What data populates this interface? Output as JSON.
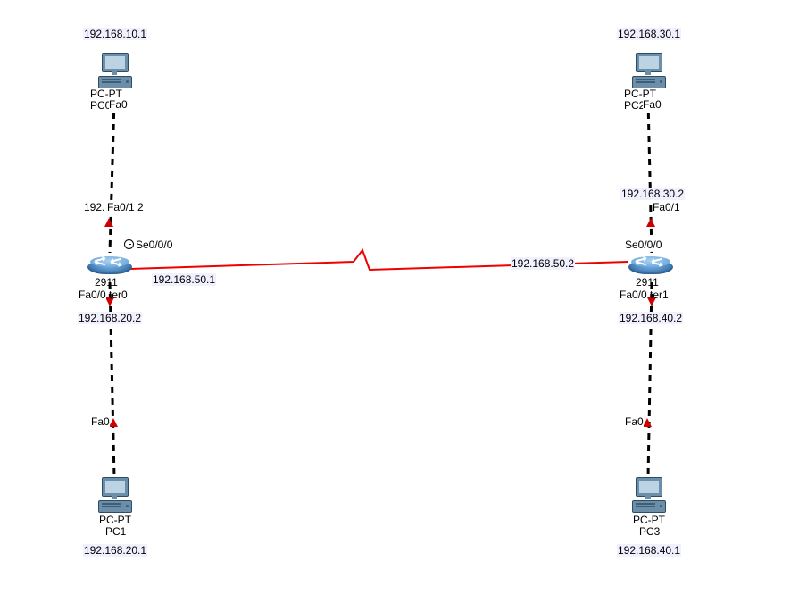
{
  "devices": {
    "pc0": {
      "type_label": "PC-PT",
      "host_label": "PC0",
      "ip": "192.168.10.1",
      "port": "Fa0"
    },
    "pc1": {
      "type_label": "PC-PT",
      "host_label": "PC1",
      "ip": "192.168.20.1",
      "port": "Fa0"
    },
    "pc2": {
      "type_label": "PC-PT",
      "host_label": "PC2",
      "ip": "192.168.30.1",
      "port": "Fa0"
    },
    "pc3": {
      "type_label": "PC-PT",
      "host_label": "PC3",
      "ip": "192.168.40.1",
      "port": "Fa0"
    },
    "router0": {
      "model": "2911",
      "host_label": "Router0",
      "fa01_ip": "192.168.10.2",
      "fa01_port": "Fa0/1",
      "fa00_ip": "192.168.20.2",
      "fa00_port": "Fa0/0",
      "se_port": "Se0/0/0",
      "se_ip": "192.168.50.1"
    },
    "router1": {
      "model": "2911",
      "host_label": "Router1",
      "fa01_ip": "192.168.30.2",
      "fa01_port": "Fa0/1",
      "fa00_ip": "192.168.40.2",
      "fa00_port": "Fa0/0",
      "se_port": "Se0/0/0",
      "se_ip": "192.168.50.2"
    }
  },
  "labels": {
    "r0_fa01_ip_partial": "192.",
    "r0_fa01_port_display": "Fa0/1 2"
  }
}
